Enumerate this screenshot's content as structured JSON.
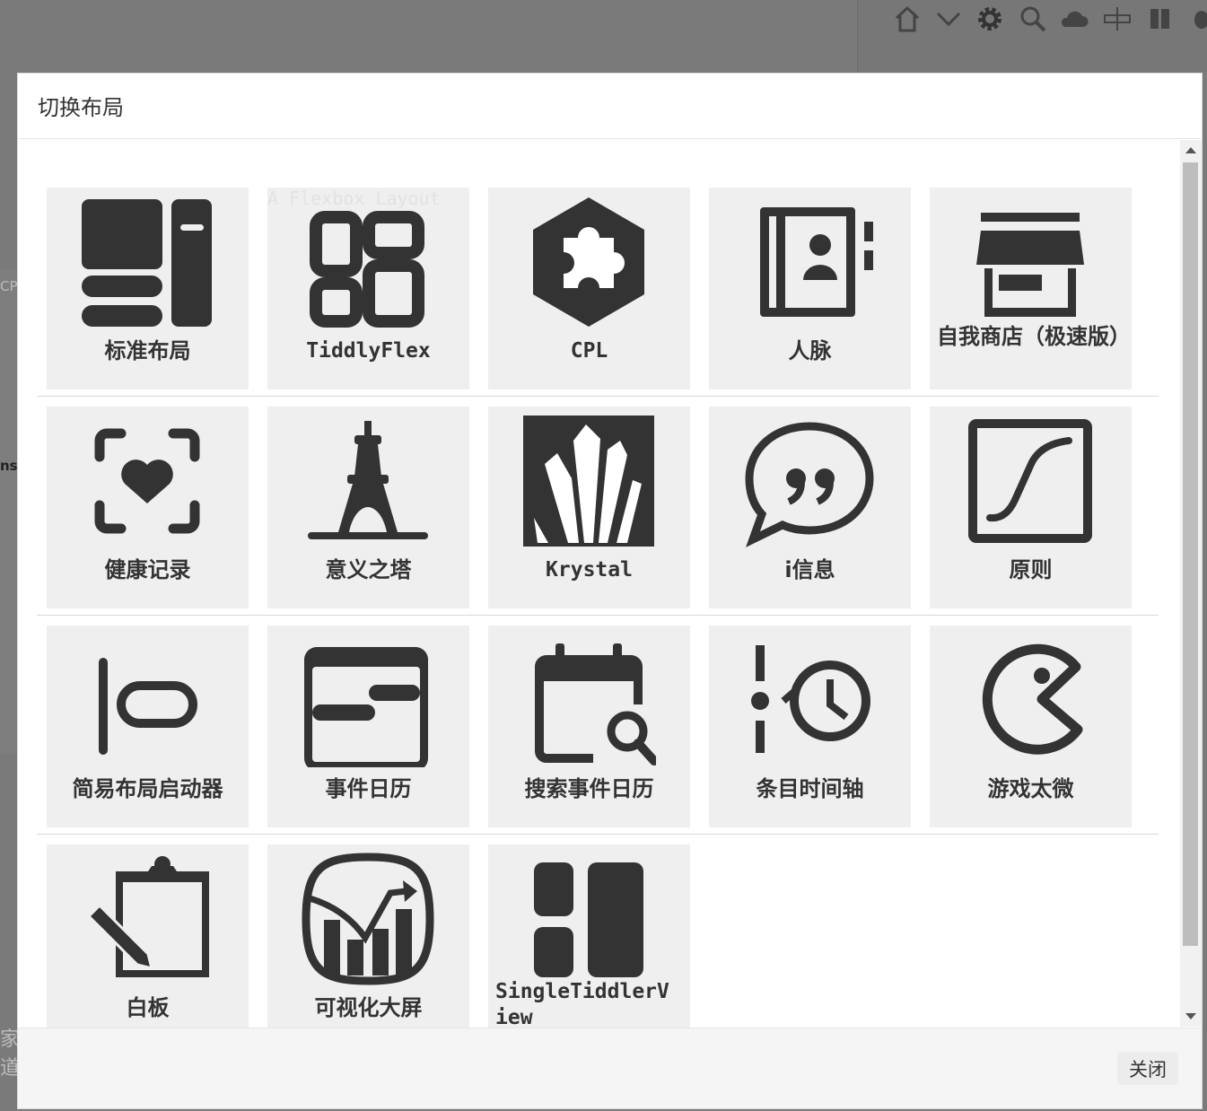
{
  "modal": {
    "title": "切换布局",
    "close_label": "关闭"
  },
  "background": {
    "fragments": [
      "CP",
      "ns",
      "家",
      "道"
    ]
  },
  "layouts": [
    {
      "label": "标准布局",
      "icon": "standard-layout-icon"
    },
    {
      "label": "TiddlyFlex",
      "icon": "flex-grid-icon",
      "watermark": "A Flexbox Layout"
    },
    {
      "label": "CPL",
      "icon": "puzzle-hexagon-icon"
    },
    {
      "label": "人脉",
      "icon": "address-book-icon"
    },
    {
      "label": "自我商店（极速版）",
      "icon": "shop-icon"
    },
    {
      "label": "健康记录",
      "icon": "heart-scan-icon"
    },
    {
      "label": "意义之塔",
      "icon": "eiffel-tower-icon"
    },
    {
      "label": "Krystal",
      "icon": "crystal-icon"
    },
    {
      "label": "i信息",
      "icon": "quote-bubble-icon"
    },
    {
      "label": "原则",
      "icon": "s-curve-icon"
    },
    {
      "label": "简易布局启动器",
      "icon": "align-left-icon"
    },
    {
      "label": "事件日历",
      "icon": "event-calendar-icon"
    },
    {
      "label": "搜索事件日历",
      "icon": "calendar-search-icon"
    },
    {
      "label": "条目时间轴",
      "icon": "timeline-clock-icon"
    },
    {
      "label": "游戏太微",
      "icon": "pacman-icon"
    },
    {
      "label": "白板",
      "icon": "whiteboard-icon"
    },
    {
      "label": "可视化大屏",
      "icon": "dashboard-chart-icon"
    },
    {
      "label": "SingleTiddlerView",
      "icon": "single-tiddler-icon"
    }
  ]
}
